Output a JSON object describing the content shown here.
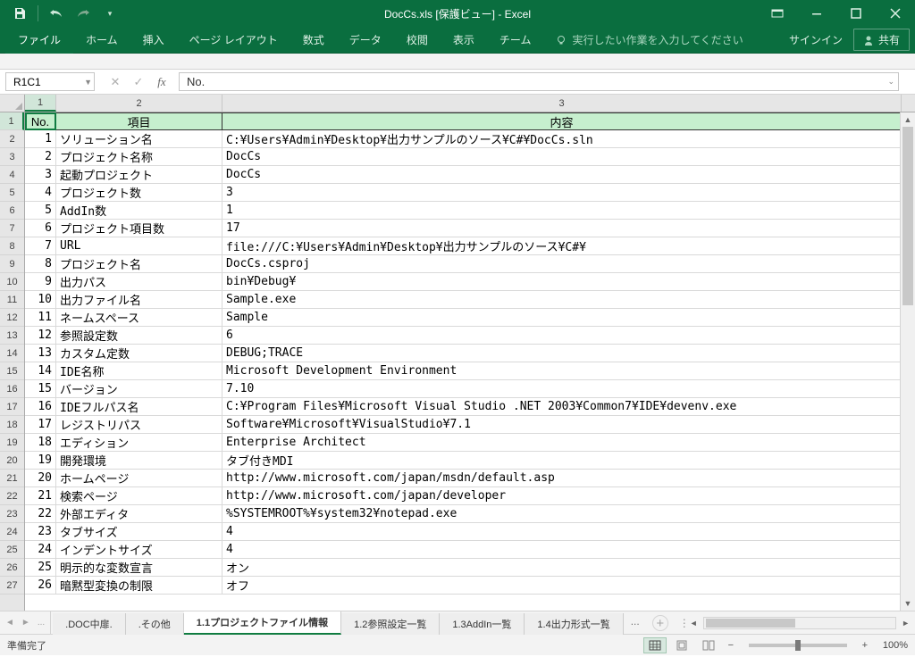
{
  "title": "DocCs.xls  [保護ビュー] - Excel",
  "qat": {
    "save": "save",
    "undo": "undo",
    "redo": "redo"
  },
  "ribbon": {
    "tabs": [
      "ファイル",
      "ホーム",
      "挿入",
      "ページ レイアウト",
      "数式",
      "データ",
      "校閲",
      "表示",
      "チーム"
    ],
    "tellme_placeholder": "実行したい作業を入力してください",
    "signin": "サインイン",
    "share": "共有"
  },
  "namebox": "R1C1",
  "formula": "No.",
  "col_headers": [
    "1",
    "2",
    "3"
  ],
  "header_row": {
    "a": "No.",
    "b": "項目",
    "c": "内容"
  },
  "rows": [
    {
      "n": "1",
      "a": "1",
      "b": "ソリューション名",
      "c": "C:¥Users¥Admin¥Desktop¥出力サンプルのソース¥C#¥DocCs.sln"
    },
    {
      "n": "2",
      "a": "2",
      "b": "プロジェクト名称",
      "c": "DocCs"
    },
    {
      "n": "3",
      "a": "3",
      "b": "起動プロジェクト",
      "c": "DocCs"
    },
    {
      "n": "4",
      "a": "4",
      "b": "プロジェクト数",
      "c": "3"
    },
    {
      "n": "5",
      "a": "5",
      "b": "AddIn数",
      "c": "1"
    },
    {
      "n": "6",
      "a": "6",
      "b": "プロジェクト項目数",
      "c": "17"
    },
    {
      "n": "7",
      "a": "7",
      "b": "URL",
      "c": "file:///C:¥Users¥Admin¥Desktop¥出力サンプルのソース¥C#¥"
    },
    {
      "n": "8",
      "a": "8",
      "b": "プロジェクト名",
      "c": "DocCs.csproj"
    },
    {
      "n": "9",
      "a": "9",
      "b": "出力パス",
      "c": "bin¥Debug¥"
    },
    {
      "n": "10",
      "a": "10",
      "b": "出力ファイル名",
      "c": "Sample.exe"
    },
    {
      "n": "11",
      "a": "11",
      "b": "ネームスペース",
      "c": "Sample"
    },
    {
      "n": "12",
      "a": "12",
      "b": "参照設定数",
      "c": "6"
    },
    {
      "n": "13",
      "a": "13",
      "b": "カスタム定数",
      "c": "DEBUG;TRACE"
    },
    {
      "n": "14",
      "a": "14",
      "b": "IDE名称",
      "c": "Microsoft Development Environment"
    },
    {
      "n": "15",
      "a": "15",
      "b": "バージョン",
      "c": "7.10"
    },
    {
      "n": "16",
      "a": "16",
      "b": "IDEフルパス名",
      "c": "C:¥Program Files¥Microsoft Visual Studio .NET 2003¥Common7¥IDE¥devenv.exe"
    },
    {
      "n": "17",
      "a": "17",
      "b": "レジストリパス",
      "c": "Software¥Microsoft¥VisualStudio¥7.1"
    },
    {
      "n": "18",
      "a": "18",
      "b": "エディション",
      "c": "Enterprise Architect"
    },
    {
      "n": "19",
      "a": "19",
      "b": "開発環境",
      "c": "タブ付きMDI"
    },
    {
      "n": "20",
      "a": "20",
      "b": "ホームページ",
      "c": "http://www.microsoft.com/japan/msdn/default.asp"
    },
    {
      "n": "21",
      "a": "21",
      "b": "検索ページ",
      "c": "http://www.microsoft.com/japan/developer"
    },
    {
      "n": "22",
      "a": "22",
      "b": "外部エディタ",
      "c": "%SYSTEMROOT%¥system32¥notepad.exe"
    },
    {
      "n": "23",
      "a": "23",
      "b": "タブサイズ",
      "c": "4"
    },
    {
      "n": "24",
      "a": "24",
      "b": "インデントサイズ",
      "c": "4"
    },
    {
      "n": "25",
      "a": "25",
      "b": "明示的な変数宣言",
      "c": "オン"
    },
    {
      "n": "26",
      "a": "26",
      "b": "暗黙型変換の制限",
      "c": "オフ"
    }
  ],
  "sheet_tabs": {
    "prev_ellipsis": "...",
    "tabs": [
      ".DOC中扉.",
      ".その他",
      "1.1プロジェクトファイル情報",
      "1.2参照設定一覧",
      "1.3AddIn一覧",
      "1.4出力形式一覧"
    ],
    "active_index": 2,
    "more": "..."
  },
  "statusbar": {
    "left": "準備完了",
    "zoom": "100%"
  }
}
